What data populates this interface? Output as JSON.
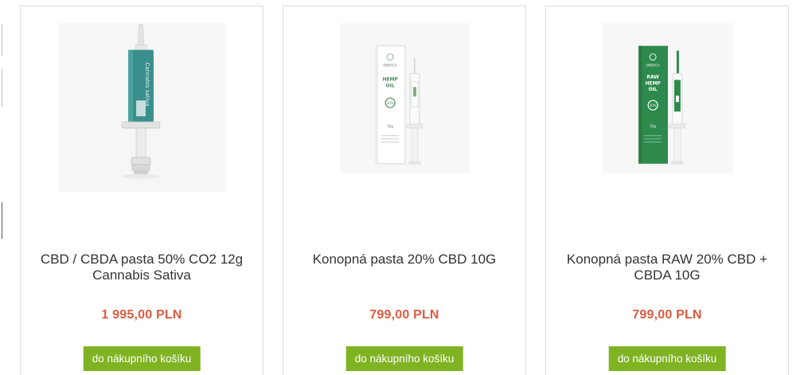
{
  "products": [
    {
      "title": "CBD / CBDA pasta 50% CO2 12g Cannabis Sativa",
      "price": "1 995,00 PLN",
      "button": "do nákupního košíku",
      "image": "cbd-syringe-teal-label",
      "image_text": "Cannabis sativa"
    },
    {
      "title": "Konopná pasta 20% CBD 10G",
      "price": "799,00 PLN",
      "button": "do nákupního košíku",
      "image": "hemp-oil-box-white-syringe",
      "brand": "ENDOCA",
      "box_label": "HEMP OIL",
      "badge": "20%",
      "weight": "10g",
      "tagline": "Unlocking the Secrets of Nature"
    },
    {
      "title": "Konopná pasta RAW 20% CBD + CBDA 10G",
      "price": "799,00 PLN",
      "button": "do nákupního košíku",
      "image": "raw-hemp-oil-box-green-syringe",
      "brand": "ENDOCA",
      "box_label": "RAW HEMP OIL",
      "badge": "20%",
      "weight": "10g",
      "tagline": "Unlocking the Secrets of Nature"
    }
  ],
  "colors": {
    "price": "#e05a3e",
    "button_bg": "#7fb322",
    "card_border": "#dcdcdc",
    "teal_label": "#3a8f8c",
    "green_box": "#2d8a4c"
  }
}
